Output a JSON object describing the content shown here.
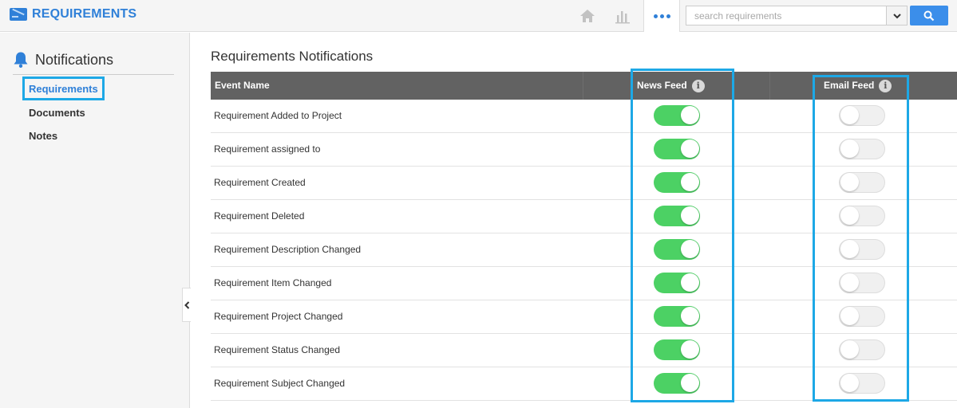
{
  "app": {
    "title": "REQUIREMENTS",
    "accent_color": "#2f80d8",
    "icons": [
      "home-icon",
      "bar-chart-icon",
      "more-dots-icon",
      "search-icon"
    ]
  },
  "search": {
    "placeholder": "search requirements",
    "value": ""
  },
  "sidebar": {
    "title": "Notifications",
    "items": [
      {
        "label": "Requirements",
        "active": true
      },
      {
        "label": "Documents",
        "active": false
      },
      {
        "label": "Notes",
        "active": false
      }
    ]
  },
  "main": {
    "title": "Requirements Notifications",
    "columns": {
      "event_name": "Event Name",
      "news_feed": "News Feed",
      "email_feed": "Email Feed"
    },
    "rows": [
      {
        "event": "Requirement Added to Project",
        "news_feed": true,
        "email_feed": false
      },
      {
        "event": "Requirement assigned to",
        "news_feed": true,
        "email_feed": false
      },
      {
        "event": "Requirement Created",
        "news_feed": true,
        "email_feed": false
      },
      {
        "event": "Requirement Deleted",
        "news_feed": true,
        "email_feed": false
      },
      {
        "event": "Requirement Description Changed",
        "news_feed": true,
        "email_feed": false
      },
      {
        "event": "Requirement Item Changed",
        "news_feed": true,
        "email_feed": false
      },
      {
        "event": "Requirement Project Changed",
        "news_feed": true,
        "email_feed": false
      },
      {
        "event": "Requirement Status Changed",
        "news_feed": true,
        "email_feed": false
      },
      {
        "event": "Requirement Subject Changed",
        "news_feed": true,
        "email_feed": false
      }
    ]
  },
  "colors": {
    "toggle_on": "#4cd164",
    "highlight": "#1da8e6",
    "header_bg": "#626262"
  }
}
